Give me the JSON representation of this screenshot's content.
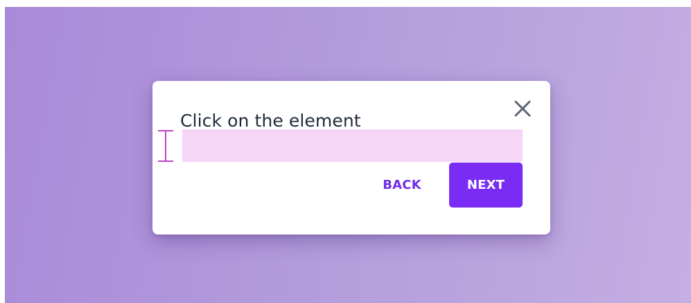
{
  "dialog": {
    "prompt": "Click on the element",
    "back_label": "BACK",
    "next_label": "NEXT",
    "close_icon": "close-icon",
    "cursor_icon": "text-cursor-icon"
  },
  "colors": {
    "background_start": "#a98ad8",
    "background_end": "#c4aee2",
    "highlight": "#f6d6f6",
    "accent": "#7a2cf5",
    "cursor": "#c03ec6",
    "text": "#1e2a3a",
    "close_icon": "#5a6472"
  }
}
